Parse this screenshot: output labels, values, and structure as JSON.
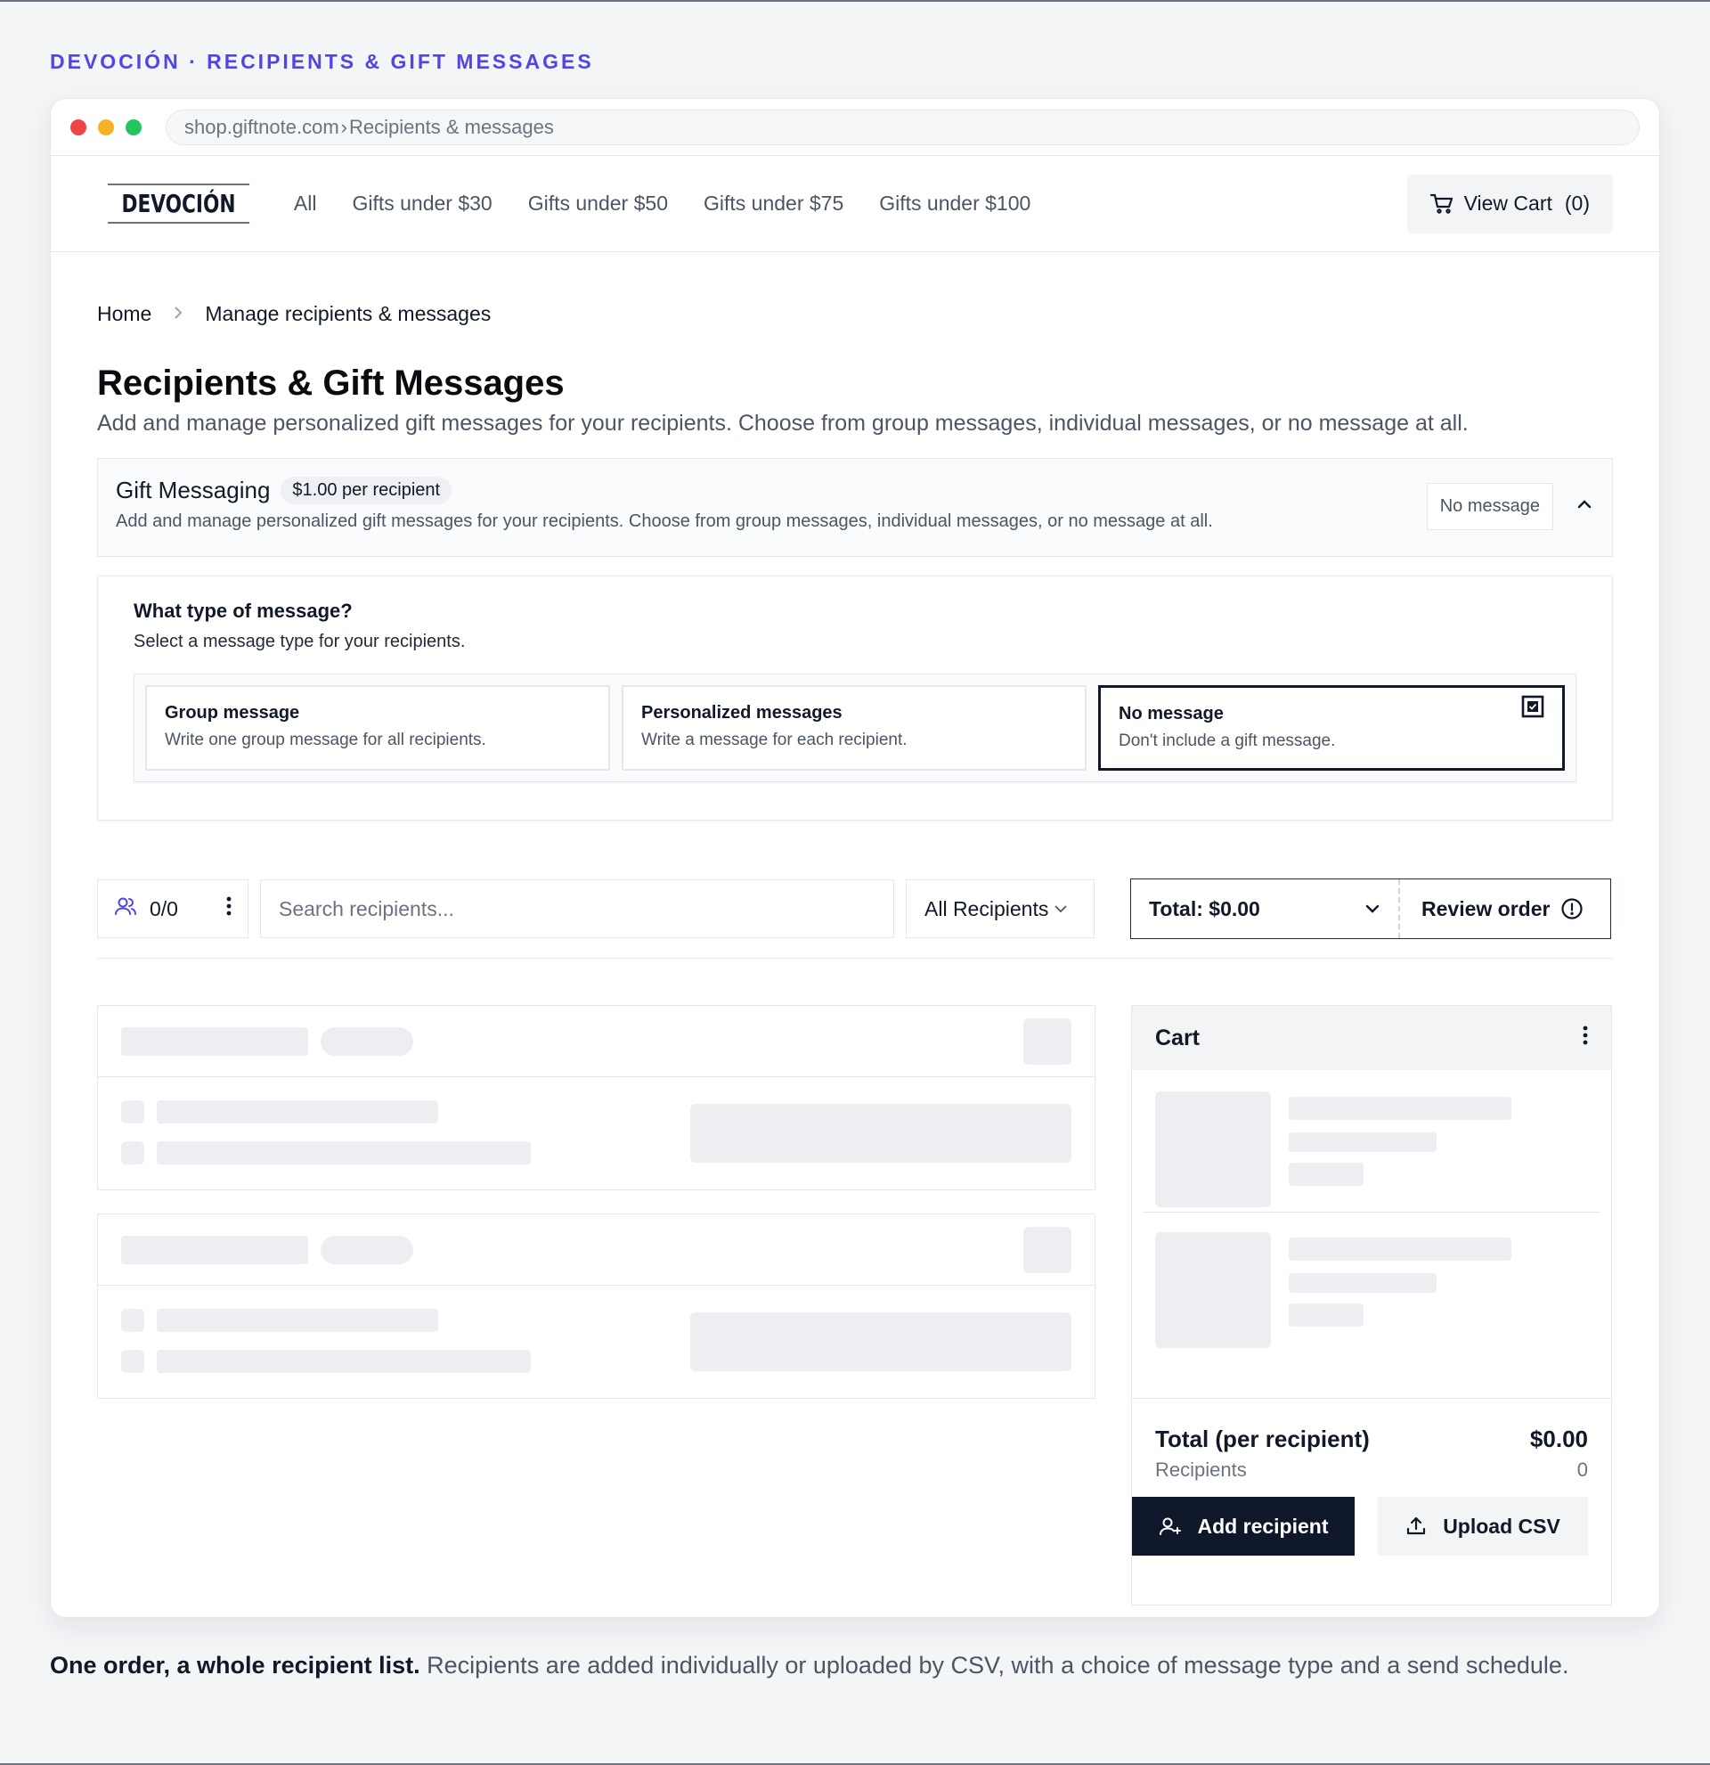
{
  "eyebrow": "DEVOCIÓN · RECIPIENTS & GIFT MESSAGES",
  "browser": {
    "url_domain": "shop.giftnote.com",
    "url_path": "Recipients & messages"
  },
  "nav": {
    "logo": "DEVOCIÓN",
    "links": [
      "All",
      "Gifts under $30",
      "Gifts under $50",
      "Gifts under $75",
      "Gifts under $100"
    ],
    "cart_label": "View Cart",
    "cart_count": "(0)"
  },
  "breadcrumb": {
    "home": "Home",
    "current": "Manage recipients & messages"
  },
  "page": {
    "title": "Recipients & Gift Messages",
    "subtitle": "Add and manage personalized gift messages for your recipients. Choose from group messages, individual messages, or no message at all."
  },
  "gift_messaging": {
    "title": "Gift Messaging",
    "price_pill": "$1.00 per recipient",
    "description": "Add and manage personalized gift messages for your recipients. Choose from group messages, individual messages, or no message at all.",
    "status": "No message"
  },
  "message_type": {
    "question": "What type of message?",
    "instruction": "Select a message type for your recipients.",
    "options": [
      {
        "title": "Group message",
        "desc": "Write one group message for all recipients.",
        "selected": false
      },
      {
        "title": "Personalized messages",
        "desc": "Write a message for each recipient.",
        "selected": false
      },
      {
        "title": "No message",
        "desc": "Don't include a gift message.",
        "selected": true
      }
    ]
  },
  "toolbar": {
    "count": "0/0",
    "search_placeholder": "Search recipients...",
    "filter": "All Recipients",
    "total": "Total: $0.00",
    "review": "Review order"
  },
  "cart": {
    "title": "Cart",
    "total_label": "Total (per recipient)",
    "total_value": "$0.00",
    "recipients_label": "Recipients",
    "recipients_value": "0",
    "add_button": "Add recipient",
    "upload_button": "Upload CSV"
  },
  "caption": {
    "lead": "One order, a whole recipient list.",
    "body": " Recipients are added individually or uploaded by CSV, with a choice of message type and a send schedule."
  },
  "colors": {
    "accent": "#4f46e5",
    "primary_dark": "#0f172a",
    "skeleton": "#eceef1"
  }
}
